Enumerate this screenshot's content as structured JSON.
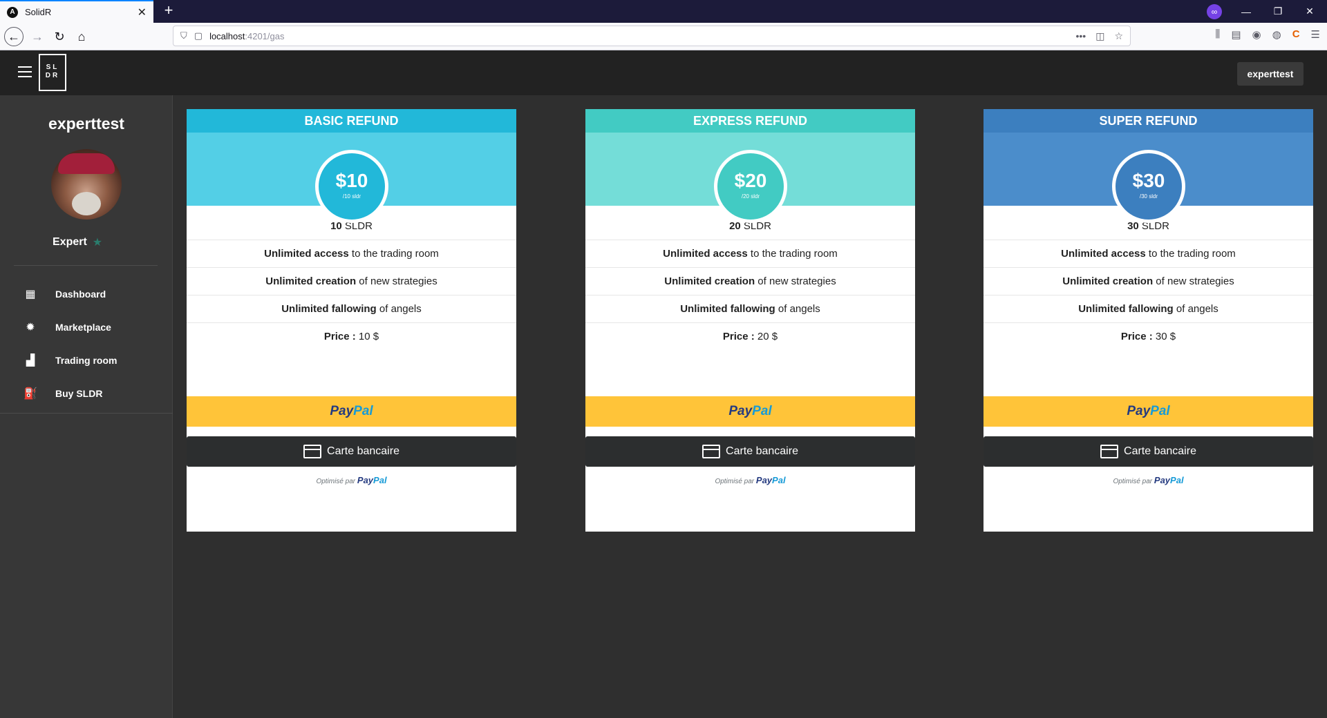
{
  "browser": {
    "tab_title": "SolidR",
    "tab_close": "✕",
    "new_tab": "+",
    "url_host": "localhost",
    "url_path": ":4201/gas"
  },
  "app": {
    "user_button": "experttest",
    "logo_text": "SL DR"
  },
  "sidebar": {
    "username": "experttest",
    "role": "Expert",
    "items": [
      {
        "label": "Dashboard",
        "icon": "dashboard-icon"
      },
      {
        "label": "Marketplace",
        "icon": "lightbulb-icon"
      },
      {
        "label": "Trading room",
        "icon": "bar-chart-icon"
      },
      {
        "label": "Buy SLDR",
        "icon": "gas-station-icon"
      }
    ]
  },
  "colors": {
    "basic_header": "#22b8d9",
    "basic_band": "#53cfe6",
    "express_header": "#42cbc3",
    "express_band": "#74ddd8",
    "super_header": "#3c7fbf",
    "super_band": "#4b8dcb"
  },
  "cards": [
    {
      "title": "BASIC REFUND",
      "amount": "$10",
      "per": "/10 sldr",
      "sldr_num": "10",
      "sldr_unit": " SLDR",
      "feat1_b": "Unlimited access",
      "feat1_t": " to the trading room",
      "feat2_b": "Unlimited creation",
      "feat2_t": " of new strategies",
      "feat3_b": "Unlimited fallowing",
      "feat3_t": " of angels",
      "price_b": "Price :",
      "price_t": " 10 $"
    },
    {
      "title": "EXPRESS REFUND",
      "amount": "$20",
      "per": "/20 sldr",
      "sldr_num": "20",
      "sldr_unit": " SLDR",
      "feat1_b": "Unlimited access",
      "feat1_t": " to the trading room",
      "feat2_b": "Unlimited creation",
      "feat2_t": " of new strategies",
      "feat3_b": "Unlimited fallowing",
      "feat3_t": " of angels",
      "price_b": "Price :",
      "price_t": " 20 $"
    },
    {
      "title": "SUPER REFUND",
      "amount": "$30",
      "per": "/30 sldr",
      "sldr_num": "30",
      "sldr_unit": " SLDR",
      "feat1_b": "Unlimited access",
      "feat1_t": " to the trading room",
      "feat2_b": "Unlimited creation",
      "feat2_t": " of new strategies",
      "feat3_b": "Unlimited fallowing",
      "feat3_t": " of angels",
      "price_b": "Price :",
      "price_t": " 30 $"
    }
  ],
  "payment": {
    "paypal_1": "Pay",
    "paypal_2": "Pal",
    "card_label": "Carte bancaire",
    "optimise": "Optimisé par "
  }
}
